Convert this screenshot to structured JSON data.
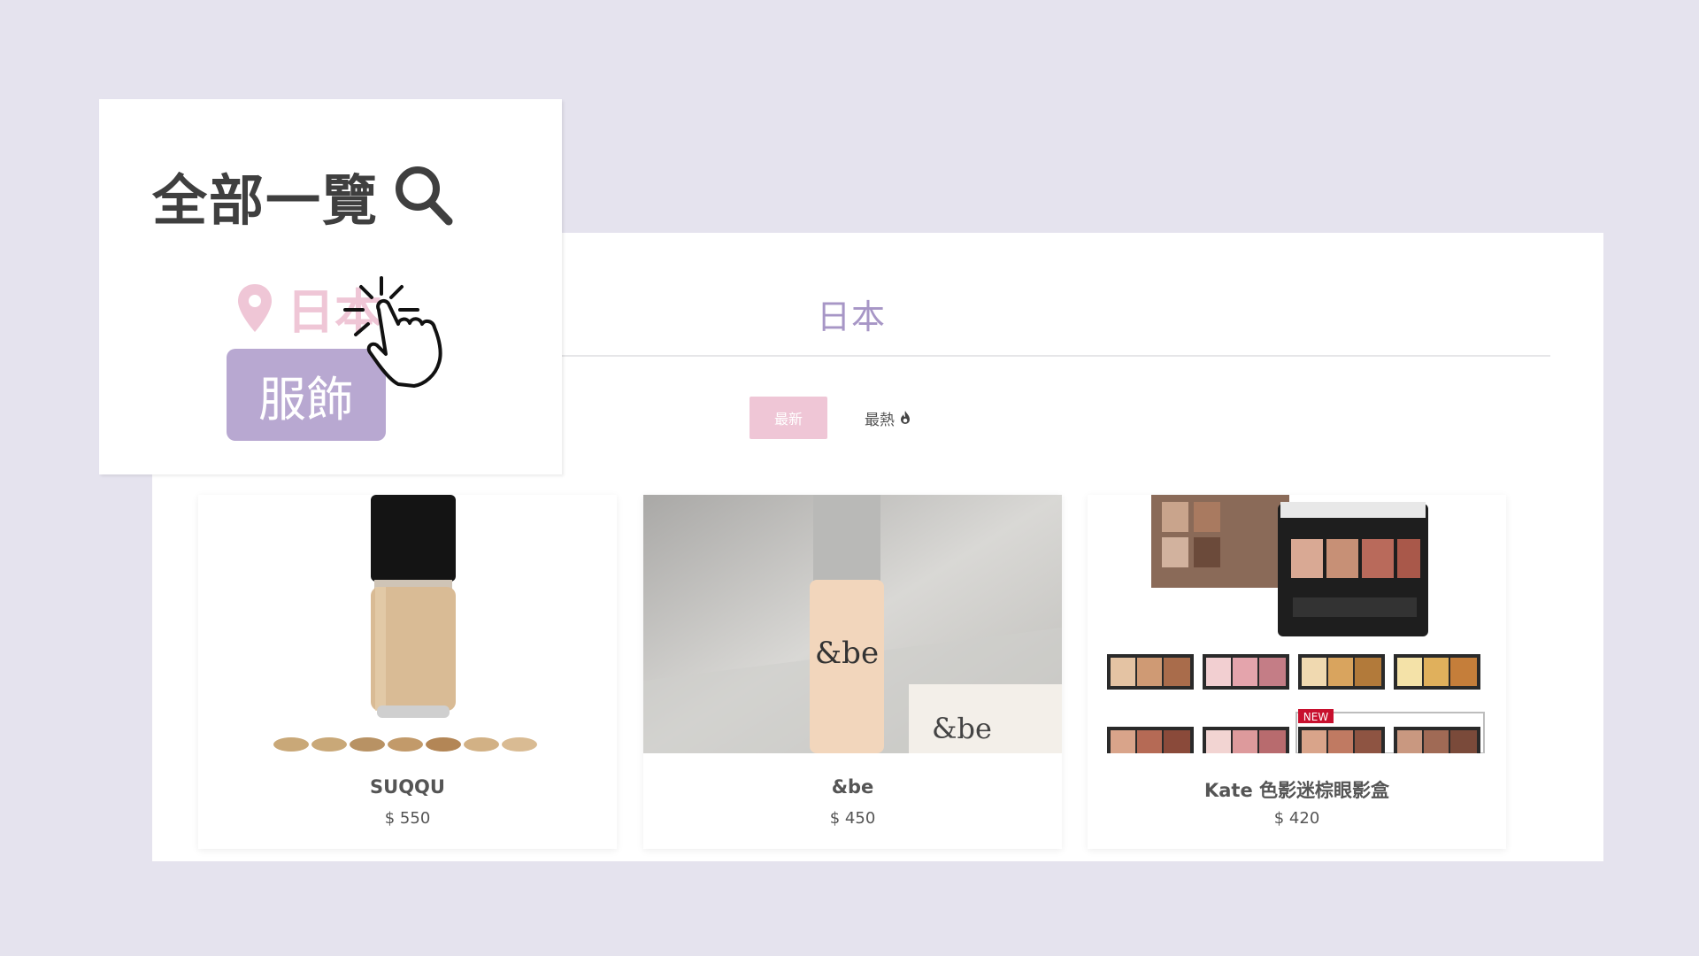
{
  "panel": {
    "country": "日本",
    "sort": {
      "newest": "最新",
      "hottest": "最熱"
    }
  },
  "products": [
    {
      "name": "SUQQU",
      "price": "$ 550"
    },
    {
      "name": "&be",
      "price": "$ 450"
    },
    {
      "name": "Kate 色影迷棕眼影盒",
      "price": "$ 420"
    }
  ],
  "inset": {
    "title": "全部一覽",
    "location": "日本",
    "category": "服飾"
  },
  "icons": {
    "search": "search-icon",
    "location": "map-pin-icon",
    "fire": "fire-icon",
    "cursor": "pointer-hand-icon"
  },
  "colors": {
    "background": "#e5e3ee",
    "accent_purple": "#b8a8d1",
    "country_purple": "#a796c6",
    "pink": "#efc6d6",
    "text_dark": "#3f3f3f"
  }
}
